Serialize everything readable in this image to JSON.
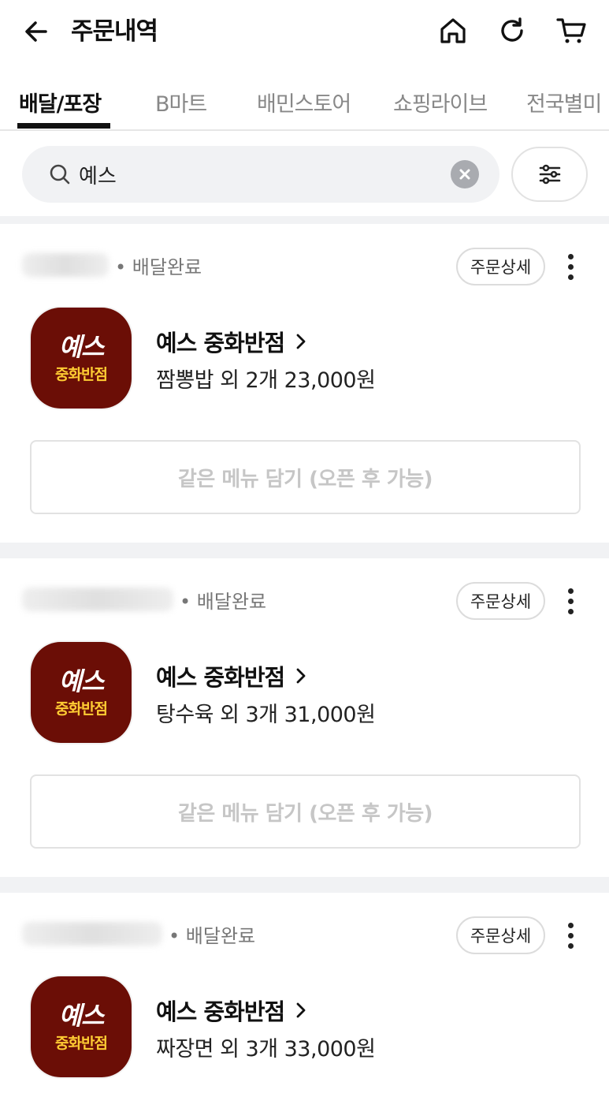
{
  "header": {
    "title": "주문내역",
    "icons": [
      "back-arrow-icon",
      "home-icon",
      "refresh-icon",
      "cart-icon"
    ]
  },
  "tabs": [
    {
      "label": "배달/포장",
      "active": true
    },
    {
      "label": "B마트",
      "active": false
    },
    {
      "label": "배민스토어",
      "active": false
    },
    {
      "label": "쇼핑라이브",
      "active": false
    },
    {
      "label": "전국별미",
      "active": false
    }
  ],
  "search": {
    "value": "예스",
    "icon": "search-icon"
  },
  "orders": [
    {
      "status": "• 배달완료",
      "detail_label": "주문상세",
      "logo_main": "예스",
      "logo_sub": "중화반점",
      "store_name": "예스 중화반점",
      "summary": "짬뽕밥 외 2개 23,000원",
      "reorder_label": "같은 메뉴 담기 (오픈 후 가능)"
    },
    {
      "status": "• 배달완료",
      "detail_label": "주문상세",
      "logo_main": "예스",
      "logo_sub": "중화반점",
      "store_name": "예스 중화반점",
      "summary": "탕수육 외 3개 31,000원",
      "reorder_label": "같은 메뉴 담기 (오픈 후 가능)"
    },
    {
      "status": "• 배달완료",
      "detail_label": "주문상세",
      "logo_main": "예스",
      "logo_sub": "중화반점",
      "store_name": "예스 중화반점",
      "summary": "짜장면 외 3개 33,000원",
      "reorder_label": "같은 메뉴 담기 (오픈 후 가능)"
    }
  ],
  "colors": {
    "logo_bg": "#6b0e06",
    "logo_sub": "#ffcc33",
    "divider": "#f1f2f4"
  }
}
